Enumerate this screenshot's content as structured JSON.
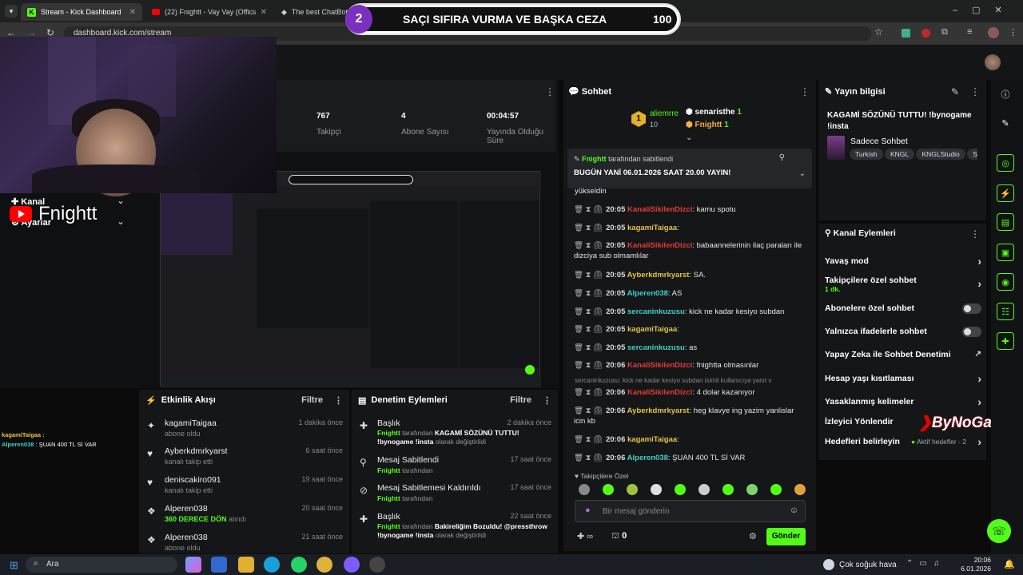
{
  "browser": {
    "tabs": [
      {
        "title": "Stream - Kick Dashboard",
        "active": true
      },
      {
        "title": "(22) Fnightt - Vay Vay (Official a",
        "active": false
      },
      {
        "title": "The best ChatBot a",
        "active": false
      }
    ],
    "url": "dashboard.kick.com/stream"
  },
  "overlay": {
    "number": "2",
    "title": "SAÇI SIFIRA VURMA VE BAŞKA CEZA",
    "score": "100"
  },
  "stream_overlay": {
    "channel_label": "Kanal",
    "settings_label": "Ayarlar",
    "name": "Fnightt"
  },
  "stats": [
    {
      "value": "767",
      "label": "Takipçi"
    },
    {
      "value": "4",
      "label": "Abone Sayısı"
    },
    {
      "value": "00:04:57",
      "label": "Yayında Olduğu Süre"
    }
  ],
  "webcam_chat": [
    {
      "user": "kagamiTaigaa",
      "text": ""
    },
    {
      "user": "Alperen038",
      "text": "ŞUAN 400 TL Sİ VAR"
    }
  ],
  "activity": {
    "title": "Etkinlik Akışı",
    "filter": "Filtre",
    "items": [
      {
        "icon": "sparkle-icon",
        "name": "kagamiTaigaa",
        "sub": "abone oldu",
        "time": "1 dakika önce"
      },
      {
        "icon": "heart-icon",
        "name": "Ayberkdmrkyarst",
        "sub": "kanalı takip etti",
        "time": "6 saat önce"
      },
      {
        "icon": "heart-icon",
        "name": "deniscakiro091",
        "sub": "kanalı takip etti",
        "time": "19 saat önce"
      },
      {
        "icon": "reward-icon",
        "name": "Alperen038",
        "sub_green": "360 DERECE DÖN",
        "sub": "alındı",
        "time": "20 saat önce"
      },
      {
        "icon": "reward-icon",
        "name": "Alperen038",
        "sub": "abone oldu",
        "time": "21 saat önce"
      }
    ]
  },
  "moderation": {
    "title": "Denetim Eylemleri",
    "filter": "Filtre",
    "items": [
      {
        "icon": "title-icon",
        "title": "Başlık",
        "user": "Fnightt",
        "by": "tarafından",
        "detail": "KAGAMİ SÖZÜNÜ TUTTU! !bynogame !insta",
        "suffix": "olarak değiştirildi",
        "time": "2 dakika önce"
      },
      {
        "icon": "pin-icon",
        "title": "Mesaj Sabitlendi",
        "user": "Fnightt",
        "by": "tarafından",
        "time": "17 saat önce"
      },
      {
        "icon": "unpin-icon",
        "title": "Mesaj Sabitlemesi Kaldırıldı",
        "user": "Fnightt",
        "by": "tarafından",
        "time": "17 saat önce"
      },
      {
        "icon": "title-icon",
        "title": "Başlık",
        "user": "Fnightt",
        "by": "tarafından",
        "detail": "Bakireliğim Bozuldu! @pressthrow !bynogame !insta",
        "suffix": "olarak değiştirildi",
        "time": "22 saat önce"
      }
    ]
  },
  "chat": {
    "title": "Sohbet",
    "top_gifters": [
      {
        "name": "aliemrre",
        "count": "10"
      },
      {
        "name": "senaristhe",
        "count": "1"
      },
      {
        "name": "Fnightt",
        "count": "1"
      }
    ],
    "pinned": {
      "by": "Fnightt",
      "by_suffix": "tarafından sabitlendi",
      "text": "BUGÜN YANİ 06.01.2026 SAAT 20.00 YAYIN!"
    },
    "partial": "yükseldin",
    "messages": [
      {
        "time": "20:05",
        "user": "KanaliSikilenDizci",
        "cls": "nmred",
        "text": "kamu spotu"
      },
      {
        "time": "20:05",
        "user": "kagamiTaigaa",
        "cls": "nmyel",
        "text": ""
      },
      {
        "time": "20:05",
        "user": "KanaliSikilenDizci",
        "cls": "nmred",
        "text": "babaannelerinin ilaç paraları ile dizciya sub olmamlılar"
      },
      {
        "time": "20:05",
        "user": "Ayberkdmrkyarst",
        "cls": "nmyel",
        "text": "SA."
      },
      {
        "time": "20:05",
        "user": "Alperen038",
        "cls": "nmcyan",
        "text": "AS"
      },
      {
        "time": "20:05",
        "user": "sercaninkuzusu",
        "cls": "nmcyan",
        "text": "kick ne kadar kesiyo subdan"
      },
      {
        "time": "20:05",
        "user": "kagamiTaigaa",
        "cls": "nmyel",
        "text": ""
      },
      {
        "time": "20:05",
        "user": "sercaninkuzusu",
        "cls": "nmcyan",
        "text": "as"
      },
      {
        "time": "20:06",
        "user": "KanaliSikilenDizci",
        "cls": "nmred",
        "text": "fnightta olmasınlar"
      }
    ],
    "reply_hint": "sercaninkuzusu: kick ne kadar kesiyo subdan isimli kullanıcıya yanıt v",
    "messages2": [
      {
        "time": "20:06",
        "user": "KanaliSikilenDizci",
        "cls": "nmred",
        "text": "4 dolar kazanıyor"
      },
      {
        "time": "20:06",
        "user": "Ayberkdmrkyarst",
        "cls": "nmyel",
        "text": "heg klavye ing yazim yanlislar icin kb"
      },
      {
        "time": "20:06",
        "user": "kagamiTaigaa",
        "cls": "nmyel",
        "text": ""
      },
      {
        "time": "20:06",
        "user": "Alperen038",
        "cls": "nmcyan",
        "text": "ŞUAN 400 TL Sİ VAR"
      }
    ],
    "emote_section": "Takipçilere Özel",
    "input_placeholder": "Bir mesaj gönderin",
    "infinity": "∞",
    "points": "0",
    "send": "Gönder"
  },
  "stream_info": {
    "title": "Yayın bilgisi",
    "stream_title": "KAGAMİ SÖZÜNÜ TUTTU! !bynogame !insta",
    "category": "Sadece Sohbet",
    "tags": [
      "Turkish",
      "KNGL",
      "KNGLStudio",
      "So"
    ]
  },
  "channel_actions": {
    "title": "Kanal Eylemleri",
    "items": [
      {
        "label": "Yavaş mod",
        "type": "chevron"
      },
      {
        "label": "Takipçilere özel sohbet",
        "sub": "1 dk.",
        "type": "chevron"
      },
      {
        "label": "Abonelere özel sohbet",
        "type": "toggle"
      },
      {
        "label": "Yalnızca ifadelerle sohbet",
        "type": "toggle"
      },
      {
        "label": "Yapay Zeka ile Sohbet Denetimi",
        "type": "external"
      },
      {
        "label": "Hesap yaşı kısıtlaması",
        "type": "chevron"
      },
      {
        "label": "Yasaklanmış kelimeler",
        "type": "chevron"
      },
      {
        "label": "İzleyici Yönlendir",
        "type": "none"
      },
      {
        "label": "Hedefleri belirleyin",
        "sub": "Aktif hedefler - 2",
        "type": "chevron"
      }
    ],
    "watermark": "ByNoGam"
  },
  "taskbar": {
    "search": "Ara",
    "weather": "Çok soğuk hava",
    "time": "20:06",
    "date": "6.01.2026"
  },
  "colors": {
    "accent": "#53fc18",
    "panel": "#151618",
    "bg": "#0b0b0c"
  }
}
